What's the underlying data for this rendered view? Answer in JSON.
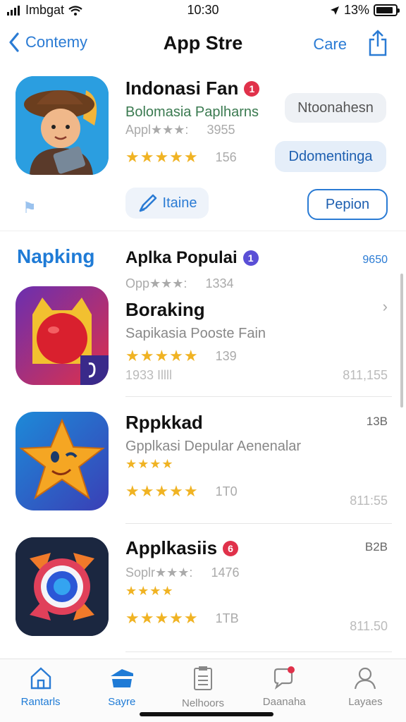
{
  "status_bar": {
    "carrier": "Imbgat",
    "time": "10:30",
    "battery": "13%",
    "battery_level": 0.9
  },
  "nav": {
    "back_label": "Contemy",
    "title": "App Stre",
    "action_label": "Care"
  },
  "featured": {
    "name": "Indonasi Fan",
    "badge": "1",
    "subtitle": "Bolomasia Paplharns",
    "meta_label": "Appl★★★:",
    "meta_count": "3955",
    "rating_stars": "★★★★★",
    "rating_count": "156",
    "button_secondary": "Ntoonahesn",
    "button_primary": "Ddomentinga",
    "install_label": "Itaine",
    "open_label": "Pepion"
  },
  "ranking": {
    "title": "Napking",
    "section_title": "Aplka Populai",
    "section_badge": "1",
    "section_code": "9650"
  },
  "apps": [
    {
      "meta_label": "Opp★★★:",
      "meta_count": "1334",
      "name": "Boraking",
      "badge": "",
      "desc": "Sapikasia Pooste Fain",
      "rating_stars": "★★★★★",
      "rating_count": "139",
      "left_note": "1933 Illll",
      "right_top": "",
      "right_bottom": "811,155"
    },
    {
      "meta_label": "",
      "meta_count": "",
      "name": "Rppkkad",
      "badge": "",
      "desc": "Gpplkasi Depular Aenenalar",
      "rating_stars": "★★★★★",
      "rating_count": "1T0",
      "small_stars": "★★★★",
      "left_note": "",
      "right_top": "13B",
      "right_bottom": "811:55"
    },
    {
      "meta_label": "Soplr★★★:",
      "meta_count": "1476",
      "name": "Applkasiis",
      "badge": "6",
      "desc": "",
      "rating_stars": "★★★★★",
      "rating_count": "1TB",
      "small_stars": "★★★★",
      "left_note": "",
      "right_top": "B2B",
      "right_bottom": "811.50"
    }
  ],
  "tabs": [
    {
      "label": "Rantarls",
      "icon": "home-icon"
    },
    {
      "label": "Sayre",
      "icon": "store-icon"
    },
    {
      "label": "Nelhoors",
      "icon": "list-icon"
    },
    {
      "label": "Daanaha",
      "icon": "chat-icon"
    },
    {
      "label": "Layaes",
      "icon": "profile-icon"
    }
  ],
  "colors": {
    "accent": "#2a7bd4",
    "star": "#f0b323",
    "badge_red": "#e0314a",
    "badge_purple": "#5a4fd6"
  }
}
